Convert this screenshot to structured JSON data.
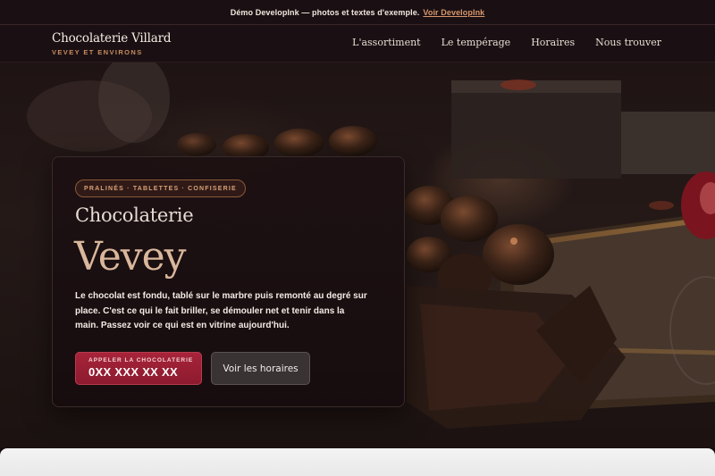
{
  "demo_bar": {
    "text": "Démo DevelopInk — photos et textes d'exemple.",
    "link_label": "Voir DevelopInk"
  },
  "header": {
    "brand_name": "Chocolaterie Villard",
    "brand_sub": "VEVEY ET ENVIRONS",
    "nav": [
      {
        "label": "L'assortiment"
      },
      {
        "label": "Le tempérage"
      },
      {
        "label": "Horaires"
      },
      {
        "label": "Nous trouver"
      }
    ]
  },
  "hero": {
    "tags": "PRALINÉS · TABLETTES · CONFISERIE",
    "kicker": "Chocolaterie",
    "title": "Vevey",
    "description": "Le chocolat est fondu, tablé sur le marbre puis remonté au degré sur place. C'est ce qui le fait briller, se démouler net et tenir dans la main. Passez voir ce qui est en vitrine aujourd'hui.",
    "cta_call_label": "APPELER LA CHOCOLATERIE",
    "cta_call_phone": "0XX XXX XX XX",
    "cta_hours_label": "Voir les horaires"
  },
  "colors": {
    "accent": "#c88b5e",
    "cta": "#9b1f34",
    "background": "#140b0d"
  }
}
